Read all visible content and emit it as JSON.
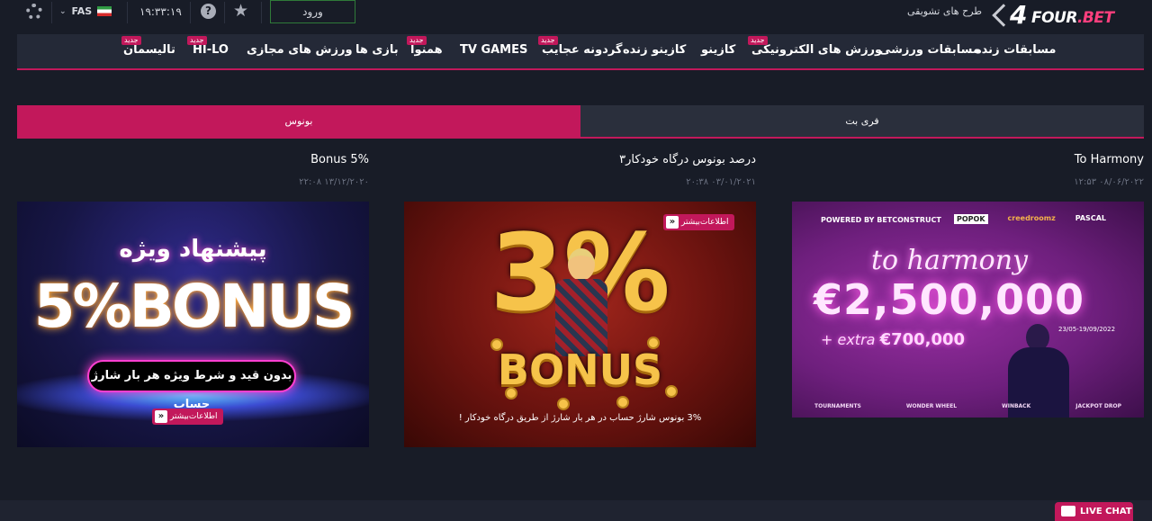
{
  "topbar": {
    "language": "FAS",
    "time": "۱۹:۳۳:۱۹",
    "help_glyph": "?",
    "login_label": "ورود",
    "promo_link": "طرح های تشویقی",
    "logo": {
      "digit": "4",
      "text_main": "FOUR",
      "text_accent": ".BET"
    }
  },
  "nav": {
    "badge_label": "جدید",
    "items": [
      {
        "label": "مسابقات زنده"
      },
      {
        "label": "مسابقات ورزشی"
      },
      {
        "label": "ورزش های الکترونیکی"
      },
      {
        "label": "کازینو"
      },
      {
        "label": "کازینو زنده"
      },
      {
        "label": "گردونه عجایب"
      },
      {
        "label": "TV GAMES"
      },
      {
        "label": "همنوا"
      },
      {
        "label": "بازی ها"
      },
      {
        "label": "ورزش های مجازی"
      },
      {
        "label": "HI-LO"
      },
      {
        "label": "تالیسمان"
      }
    ]
  },
  "tabs": {
    "bonus": "بونوس",
    "freebet": "فری بت"
  },
  "cards": [
    {
      "title": "Bonus 5%",
      "date": "۲۲:۰۸ ۱۳/۱۲/۲۰۲۰",
      "banner": {
        "headline": "پیشنهاد ویژه",
        "big_text": "5%BONUS",
        "pill_text": "بدون قید و شرط ویژه هر بار شارژ حساب",
        "more_label": "اطلاعات‌بیشتر"
      }
    },
    {
      "title": "۳درصد بونوس درگاه خودکار",
      "date": "۲۰:۳۸ ۰۳/۰۱/۲۰۲۱",
      "banner": {
        "big_text": "3%",
        "bonus_text": "BONUS",
        "note": "3% بونوس شارژ حساب در هر بار شارژ از طریق درگاه خودکار !",
        "more_label": "اطلاعات‌بیشتر"
      }
    },
    {
      "title": "To Harmony",
      "date": "۱۲:۵۳ ۰۸/۰۶/۲۰۲۲",
      "banner": {
        "powered": "POWERED BY BETCONSTRUCT",
        "sponsors": [
          "POPOK",
          "creedroomz",
          "PASCAL"
        ],
        "headline": "to harmony",
        "amount": "€2,500,000",
        "extra_prefix": "+ extra",
        "extra_amount": "€700,000",
        "dates": "23/05-19/09/2022",
        "footer": [
          "TOURNAMENTS",
          "WONDER WHEEL",
          "WINBACK",
          "JACKPOT DROP"
        ]
      }
    }
  ],
  "livechat": "LIVE CHAT",
  "colors": {
    "accent": "#c2185b",
    "background": "#181c27",
    "nav": "#242937"
  }
}
